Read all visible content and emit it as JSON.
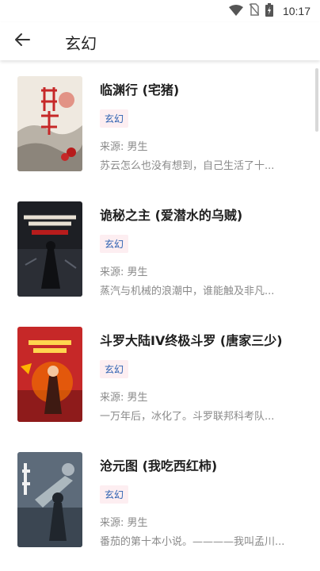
{
  "status_bar": {
    "time": "10:17",
    "icons": [
      "wifi-icon",
      "no-sim-icon",
      "battery-icon"
    ]
  },
  "app_bar": {
    "title": "玄幻",
    "back_icon": "arrow-left-icon"
  },
  "books": [
    {
      "title": "临渊行 (宅猪)",
      "tag": "玄幻",
      "source": "来源: 男生",
      "description": "苏云怎么也没有想到，自己生活了十..."
    },
    {
      "title": "诡秘之主 (爱潜水的乌贼)",
      "tag": "玄幻",
      "source": "来源: 男生",
      "description": "蒸汽与机械的浪潮中，谁能触及非凡..."
    },
    {
      "title": "斗罗大陆IV终极斗罗 (唐家三少)",
      "tag": "玄幻",
      "source": "来源: 男生",
      "description": "一万年后，冰化了。斗罗联邦科考队..."
    },
    {
      "title": "沧元图 (我吃西红柿)",
      "tag": "玄幻",
      "source": "来源: 男生",
      "description": "番茄的第十本小说。————我叫孟川..."
    }
  ],
  "colors": {
    "tag_bg": "#fdeef1",
    "tag_text": "#2a5fb0",
    "muted_text": "#8a8a8a"
  }
}
